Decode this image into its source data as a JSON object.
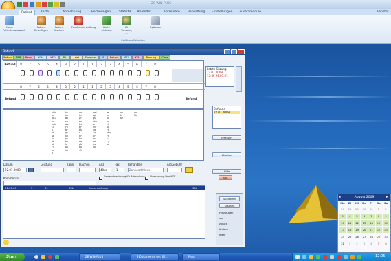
{
  "app": {
    "title": "ZE-WIN-PLUS",
    "tabs": [
      "Patient",
      "Kartei",
      "Abrechnung",
      "Rechnungen",
      "Statistik",
      "Kalender",
      "Formulare",
      "Verwaltung",
      "Einstellungen",
      "Zusatzmodule"
    ],
    "active_tab": 0,
    "right_label": "Fenster"
  },
  "ribbon": {
    "buttons": [
      "Neue Patientenauswahl",
      "Patient Einzufügen",
      "Patient löschen",
      "Familienverwaltung",
      "Karte einlesen",
      "ID Versand, ...",
      "Optionen"
    ],
    "group_label": "Geöffnete Patienten"
  },
  "dialog": {
    "title": "Befund",
    "tabs": [
      "Befund",
      "PAR",
      "Bema",
      "KCH",
      "KFO",
      "PA",
      "Leist",
      "Formular",
      "IP",
      "Befund",
      "PSI",
      "KFR",
      "Planung",
      "Cave"
    ],
    "tooth_numbers_upper": [
      "8",
      "7",
      "6",
      "5",
      "4",
      "3",
      "2",
      "1",
      "1",
      "2",
      "3",
      "4",
      "5",
      "6",
      "7",
      "8"
    ],
    "tooth_numbers_lower": [
      "8",
      "7",
      "6",
      "5",
      "4",
      "3",
      "2",
      "1",
      "1",
      "2",
      "3",
      "4",
      "5",
      "6",
      "7",
      "8"
    ],
    "row_label_upper": "Befund",
    "row_label_lower": "Befund",
    "side_panel": {
      "date_label": "Letzte Sitzung",
      "date_value": "22.07.2009",
      "status_value": "13:05 26.07.21",
      "list_label": "Befunde",
      "list_item": "22.07.2009"
    },
    "side_buttons": [
      "Erfassen",
      "Löschen",
      "Hilfe",
      "Drucken"
    ],
    "code_columns": [
      [
        "ufk",
        "ur",
        "bel",
        "kr",
        "vrk",
        "la",
        "k",
        "hk",
        "sb",
        "vu",
        "bb",
        "kk",
        "rv",
        "kv",
        "b"
      ],
      [
        "kr",
        "kv",
        "mk",
        "sp",
        "mkv",
        "rv",
        "br",
        "gr",
        "kv",
        "pk",
        "bk",
        "k",
        "pk",
        "",
        "hk"
      ],
      [
        "ww",
        "kv",
        "gr",
        "mw",
        "bs",
        "br",
        "bk",
        "w",
        "kr",
        "kv",
        "ww",
        "pk",
        "",
        "bk",
        "sl"
      ],
      [
        "bel",
        "sp",
        "gs",
        "pkv",
        "kr",
        "hv",
        "ha",
        "la",
        "kr",
        "hs",
        "ka",
        "bs",
        "hk",
        "",
        ""
      ],
      [
        "am",
        "ka",
        "kk",
        "kv",
        "zk",
        "pk",
        "rk",
        "pkv",
        "rk",
        "tz",
        "ry",
        "ka",
        "",
        "",
        ""
      ],
      [
        "wk",
        "",
        "",
        "kr",
        "kz",
        "",
        "",
        "",
        "",
        "",
        "",
        "",
        "",
        "",
        ""
      ],
      [
        "ww",
        "",
        "",
        "hk",
        "",
        "",
        "",
        "",
        "",
        "",
        "",
        "",
        "",
        "",
        ""
      ]
    ],
    "form": {
      "date_label": "Datum",
      "date_value": "22.07.2009",
      "leistung_label": "Leistung",
      "zahn_label": "Zahn",
      "flaechen_label": "Flächen",
      "anz_label": "Anz",
      "anz_value": "40ke",
      "faktor_label": "Fak",
      "faktor_value": "1",
      "behandler_label": "Behandler",
      "behandler_value": "Zahnarzt Klaus",
      "art_label": "Art/Gebühr",
      "kommentar_label": "Kommentar",
      "check1": "Kassenabrechnung für Behandlung",
      "check2": "Abrechnung über KZV",
      "search_label": "ABC"
    },
    "list_row": [
      "21.07.09",
      "3",
      "01",
      "BEL",
      "Untersuchung",
      "100"
    ],
    "list_buttons": [
      "Speichern",
      "Löschen",
      "Hinzufügen",
      "vor",
      "zurück",
      "ändern",
      "mehr"
    ]
  },
  "calendar": {
    "month": "August 2009",
    "weekdays": [
      "Mo",
      "Di",
      "Mi",
      "Do",
      "Fr",
      "Sa",
      "So"
    ],
    "weeks": [
      [
        "27",
        "28",
        "29",
        "30",
        "31",
        "1",
        "2"
      ],
      [
        "3",
        "4",
        "5",
        "6",
        "7",
        "8",
        "9"
      ],
      [
        "10",
        "11",
        "12",
        "13",
        "14",
        "15",
        "16"
      ],
      [
        "17",
        "18",
        "19",
        "20",
        "21",
        "22",
        "23"
      ],
      [
        "24",
        "25",
        "26",
        "27",
        "28",
        "29",
        "30"
      ],
      [
        "31",
        "1",
        "2",
        "3",
        "4",
        "5",
        "6"
      ]
    ]
  },
  "taskbar": {
    "start_label": "Start",
    "tasks": [
      "ZE-WIN-PLUS",
      "3 Dokumente und Ei...",
      "Paint"
    ],
    "clock": "12:05"
  }
}
